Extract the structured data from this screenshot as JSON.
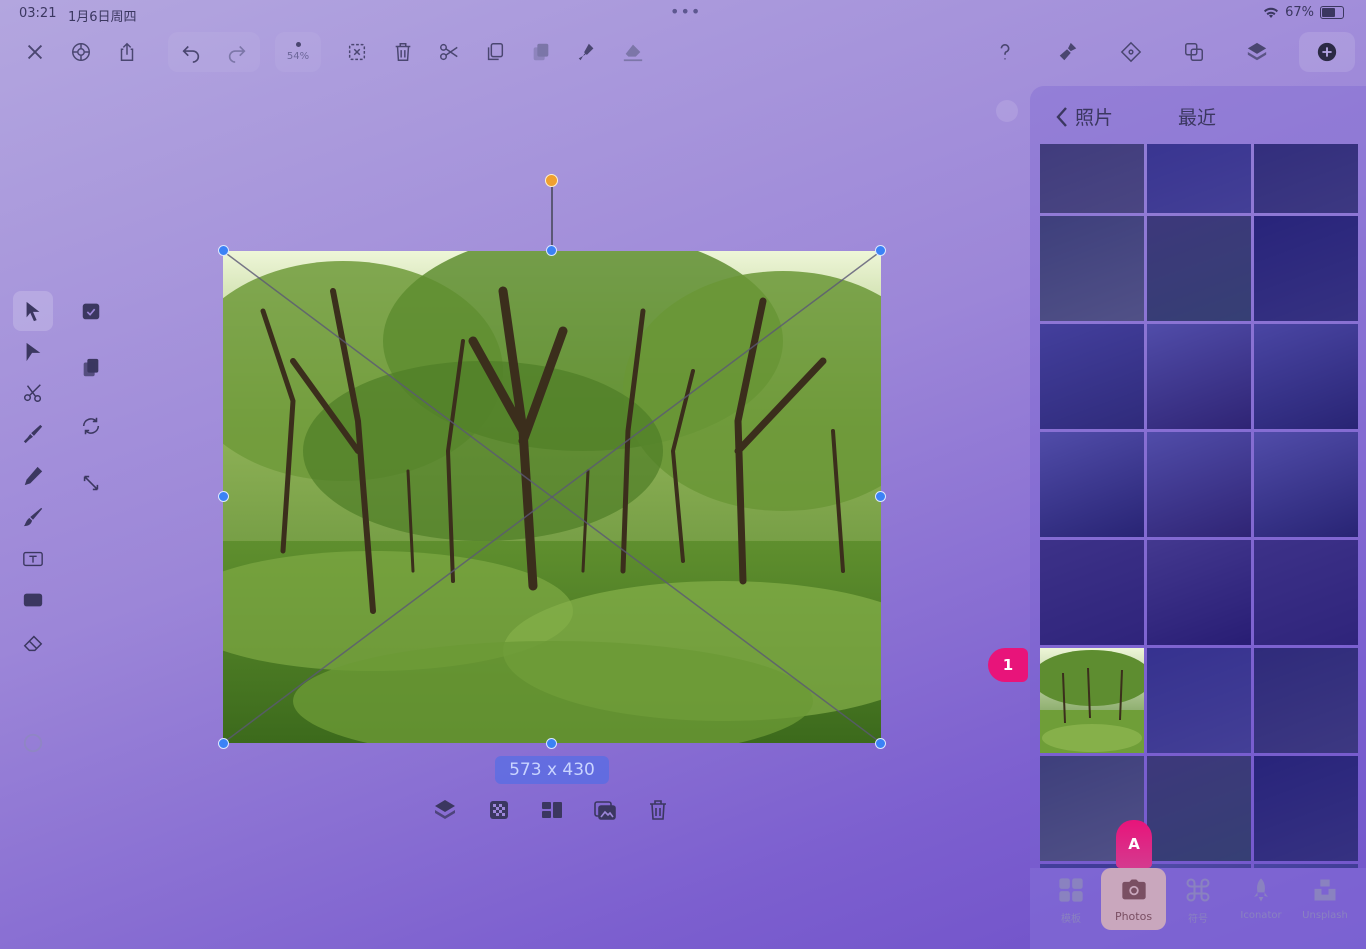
{
  "status_bar": {
    "time": "03:21",
    "date": "1月6日周四",
    "battery": "67%"
  },
  "toolbar": {
    "zoom": "54%",
    "left_icons": [
      "close-icon",
      "settings-icon",
      "share-icon"
    ],
    "history_icons": [
      "undo-icon",
      "redo-icon"
    ],
    "edit_icons": [
      "deselect-icon",
      "trash-icon",
      "scissors-icon",
      "copy-icon",
      "paste-icon",
      "paste-style-icon",
      "fill-icon"
    ],
    "right_icons": [
      "help-icon",
      "brush-tool-icon",
      "snap-icon",
      "boolean-icon",
      "layers-icon",
      "add-icon"
    ]
  },
  "left_tools": [
    "select-icon",
    "direct-select-icon",
    "scissors-icon",
    "pen-icon",
    "pencil-icon",
    "brush-icon",
    "text-icon",
    "shape-icon",
    "eraser-icon"
  ],
  "context_tools": [
    "mask-icon",
    "duplicate-icon",
    "rotate-icon",
    "resize-icon"
  ],
  "canvas": {
    "size_label": "573 x 430"
  },
  "image_tools": [
    "arrange-icon",
    "transparency-icon",
    "split-icon",
    "replace-image-icon",
    "delete-icon"
  ],
  "photo_panel": {
    "back_label": "照片",
    "title": "最近",
    "selected_index": 15
  },
  "bottom_tabs": [
    {
      "label": "模板",
      "icon": "grid-icon"
    },
    {
      "label": "Photos",
      "icon": "camera-icon"
    },
    {
      "label": "符号",
      "icon": "command-icon"
    },
    {
      "label": "Iconator",
      "icon": "rocket-icon"
    },
    {
      "label": "Unsplash",
      "icon": "unsplash-icon"
    }
  ],
  "markers": {
    "one": "1",
    "a": "A"
  },
  "colors": {
    "accent": "#3b82f6",
    "marker": "#e8147a",
    "rotate_handle": "#f0a030"
  }
}
